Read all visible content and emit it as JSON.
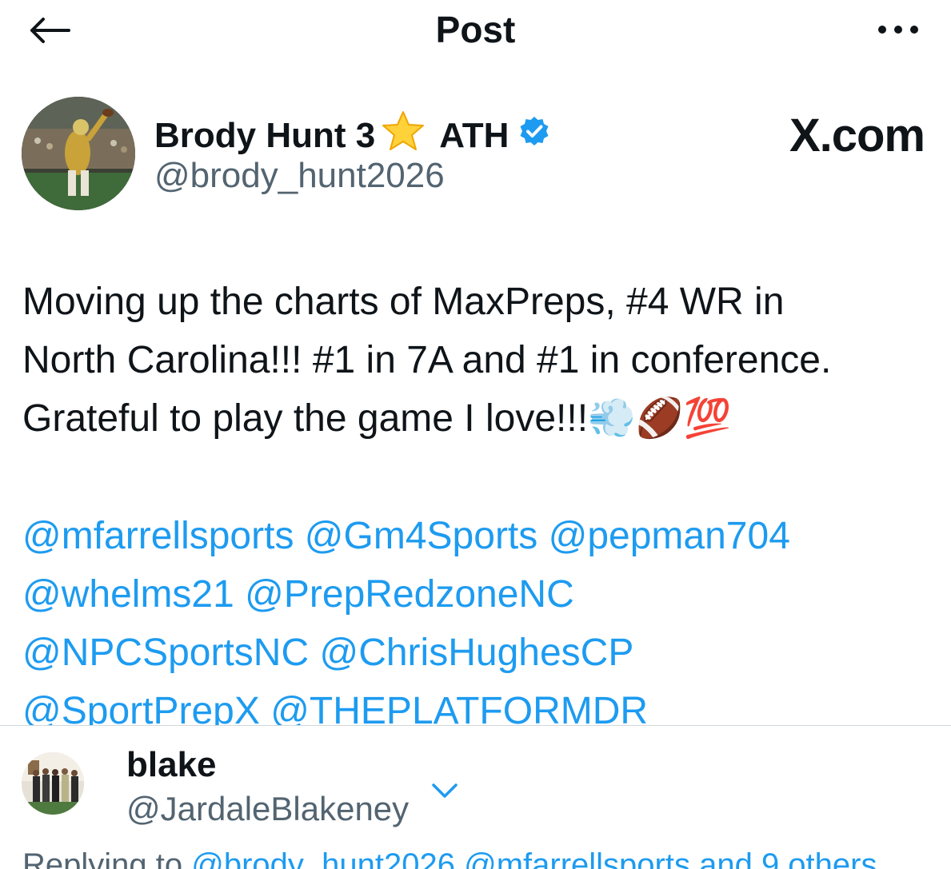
{
  "header": {
    "title": "Post",
    "back_icon": "arrow-left-icon",
    "more_icon": "more-horizontal-icon"
  },
  "post": {
    "author_name": "Brody Hunt 3",
    "author_emoji": "⭐",
    "author_suffix": "ATH",
    "handle": "@brody_hunt2026",
    "verified_color": "#1d9bf0",
    "source_watermark": "X.com",
    "text_line1": "Moving up the charts of MaxPreps, #4 WR in",
    "text_line2": "North Carolina!!! #1 in 7A and #1 in conference.",
    "text_line3": "Grateful to play the game I love!!!",
    "text_emojis": "💨🏈💯",
    "mentions": [
      "@mfarrellsports",
      "@Gm4Sports",
      "@pepman704",
      "@whelms21",
      "@PrepRedzoneNC",
      "@NPCSportsNC",
      "@ChrisHughesCP",
      "@SportPrepX",
      "@THEPLATFORMDR"
    ]
  },
  "reply": {
    "name": "blake",
    "handle": "@JardaleBlakeney",
    "replying_prefix": "Replying to",
    "replying_links": "@brody_hunt2026 @mfarrellsports and 9 others"
  },
  "colors": {
    "link": "#1d9bf0",
    "secondary_text": "#536471",
    "divider": "#cfd9de"
  }
}
